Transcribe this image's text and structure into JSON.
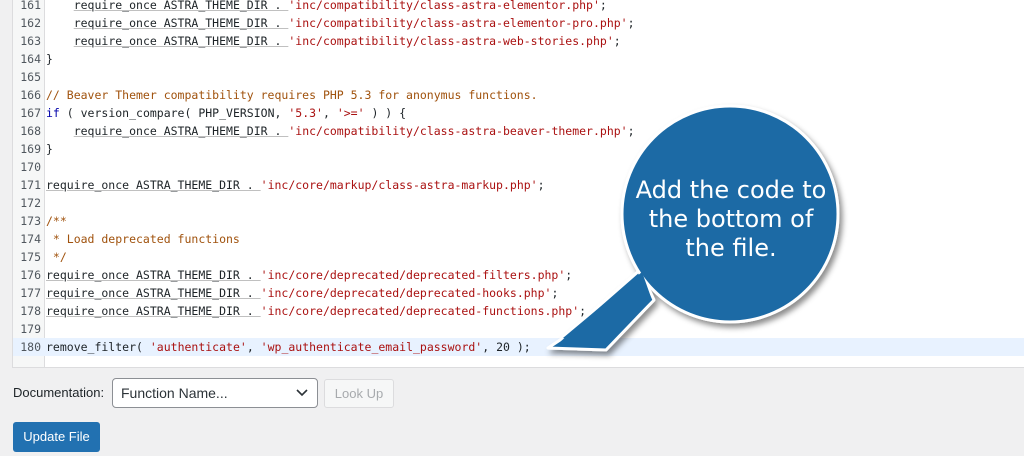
{
  "editor": {
    "lines": [
      {
        "num": "161",
        "indent": "    ",
        "pre": "require_once ASTRA_THEME_DIR . ",
        "str": "'inc/compatibility/class-astra-elementor.php'",
        "post": ";"
      },
      {
        "num": "162",
        "indent": "    ",
        "pre": "require_once ASTRA_THEME_DIR . ",
        "str": "'inc/compatibility/class-astra-elementor-pro.php'",
        "post": ";"
      },
      {
        "num": "163",
        "indent": "    ",
        "pre": "require_once ASTRA_THEME_DIR . ",
        "str": "'inc/compatibility/class-astra-web-stories.php'",
        "post": ";"
      },
      {
        "num": "164",
        "text": "}"
      },
      {
        "num": "165",
        "text": ""
      },
      {
        "num": "166",
        "comment": "// Beaver Themer compatibility requires PHP 5.3 for anonymus functions."
      },
      {
        "num": "167",
        "kw": "if",
        "rest1": " ( version_compare( PHP_VERSION, ",
        "s1": "'5.3'",
        "mid": ", ",
        "s2": "'>='",
        "rest2": " ) ) {"
      },
      {
        "num": "168",
        "indent": "    ",
        "pre": "require_once ASTRA_THEME_DIR . ",
        "str": "'inc/compatibility/class-astra-beaver-themer.php'",
        "post": ";"
      },
      {
        "num": "169",
        "text": "}"
      },
      {
        "num": "170",
        "text": ""
      },
      {
        "num": "171",
        "pre": "require_once ASTRA_THEME_DIR . ",
        "str": "'inc/core/markup/class-astra-markup.php'",
        "post": ";"
      },
      {
        "num": "172",
        "text": ""
      },
      {
        "num": "173",
        "comment": "/**"
      },
      {
        "num": "174",
        "comment": " * Load deprecated functions"
      },
      {
        "num": "175",
        "comment": " */"
      },
      {
        "num": "176",
        "pre": "require_once ASTRA_THEME_DIR . ",
        "str": "'inc/core/deprecated/deprecated-filters.php'",
        "post": ";"
      },
      {
        "num": "177",
        "pre": "require_once ASTRA_THEME_DIR . ",
        "str": "'inc/core/deprecated/deprecated-hooks.php'",
        "post": ";"
      },
      {
        "num": "178",
        "pre": "require_once ASTRA_THEME_DIR . ",
        "str": "'inc/core/deprecated/deprecated-functions.php'",
        "post": ";"
      },
      {
        "num": "179",
        "text": ""
      },
      {
        "num": "180",
        "active": true,
        "fn": "remove_filter",
        "a": "( ",
        "s1": "'authenticate'",
        "b": ", ",
        "s2": "'wp_authenticate_email_password'",
        "c": ", 20 );"
      }
    ]
  },
  "documentation": {
    "label": "Documentation:",
    "select_value": "Function Name...",
    "lookup_label": "Look Up"
  },
  "update_label": "Update File",
  "callout": {
    "text_lines": [
      "Add the code to",
      "the bottom of",
      "the file."
    ],
    "color": "#1d6aa5"
  }
}
